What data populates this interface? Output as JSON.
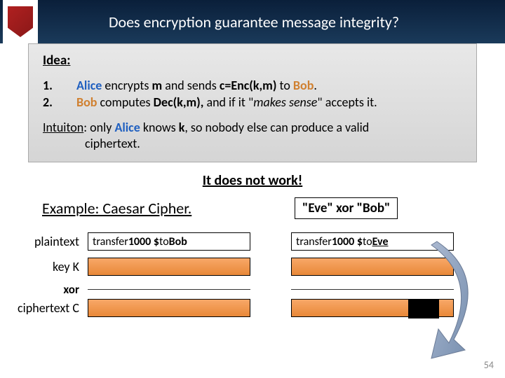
{
  "header": {
    "title": "Does encryption guarantee message integrity?"
  },
  "idea": {
    "label": "Idea:",
    "num1": "1.",
    "num2": "2.",
    "line1a": "Alice",
    "line1b": " encrypts ",
    "line1c": "m",
    "line1d": " and sends ",
    "line1e": "c=Enc(k,m)",
    "line1f": " to ",
    "line1g": "Bob",
    "line1h": ".",
    "line2a": "Bob",
    "line2b": " computes ",
    "line2c": "Dec(k,m),",
    "line2d": " and if it \"",
    "line2e": "makes sense",
    "line2f": "\" accepts it.",
    "intuition_u": "Intuiton",
    "intuition_a": ": only ",
    "intuition_alice": "Alice",
    "intuition_b": " knows ",
    "intuition_k": "k",
    "intuition_c": ", so nobody else can produce a valid",
    "intuition_d": "ciphertext."
  },
  "notwork": "It does not work!",
  "example_title": "Example: Caesar Cipher.",
  "eve_bob": "\"Eve\" xor \"Bob\"",
  "labels": {
    "plaintext": "plaintext",
    "key": "key K",
    "xor": "xor",
    "ciphertext": "ciphertext C"
  },
  "plaintext_left_a": "transfer ",
  "plaintext_left_b": "1000 $",
  "plaintext_left_c": " to ",
  "plaintext_left_d": "Bob",
  "plaintext_right_a": "transfer ",
  "plaintext_right_b": "1000 $",
  "plaintext_right_c": " to ",
  "plaintext_right_d": "Eve",
  "page_num": "54"
}
